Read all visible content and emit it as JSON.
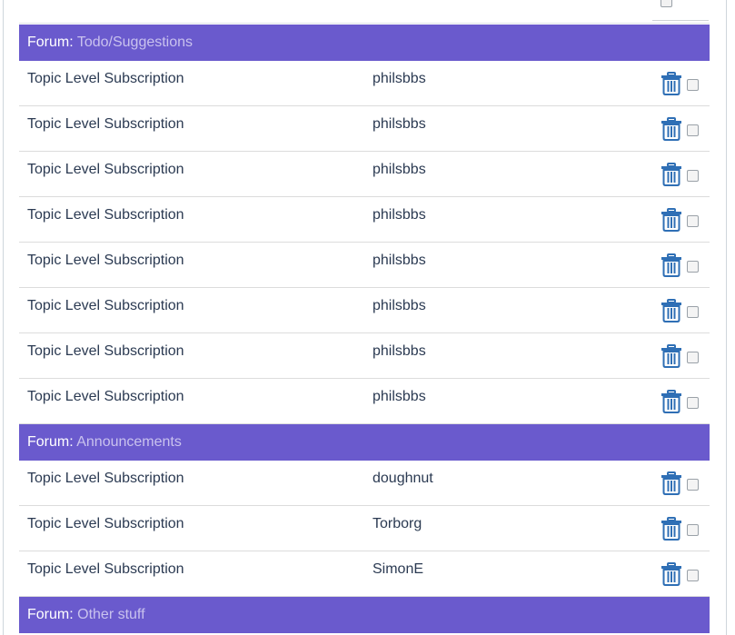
{
  "forums": [
    {
      "prefix": "Forum:",
      "name": "Todo/Suggestions",
      "rows": [
        {
          "type": "Topic Level Subscription",
          "user": "philsbbs"
        },
        {
          "type": "Topic Level Subscription",
          "user": "philsbbs"
        },
        {
          "type": "Topic Level Subscription",
          "user": "philsbbs"
        },
        {
          "type": "Topic Level Subscription",
          "user": "philsbbs"
        },
        {
          "type": "Topic Level Subscription",
          "user": "philsbbs"
        },
        {
          "type": "Topic Level Subscription",
          "user": "philsbbs"
        },
        {
          "type": "Topic Level Subscription",
          "user": "philsbbs"
        },
        {
          "type": "Topic Level Subscription",
          "user": "philsbbs"
        }
      ]
    },
    {
      "prefix": "Forum:",
      "name": "Announcements",
      "rows": [
        {
          "type": "Topic Level Subscription",
          "user": "doughnut"
        },
        {
          "type": "Topic Level Subscription",
          "user": "Torborg"
        },
        {
          "type": "Topic Level Subscription",
          "user": "SimonE"
        }
      ]
    },
    {
      "prefix": "Forum:",
      "name": "Other stuff",
      "rows": []
    }
  ],
  "colors": {
    "header_bg": "#6a5acd",
    "header_forum_name": "#c9c2ee",
    "trash_icon": "#2f6fb5",
    "row_text": "#2b3a52"
  },
  "icons": {
    "delete": "trash-icon",
    "select": "checkbox"
  }
}
